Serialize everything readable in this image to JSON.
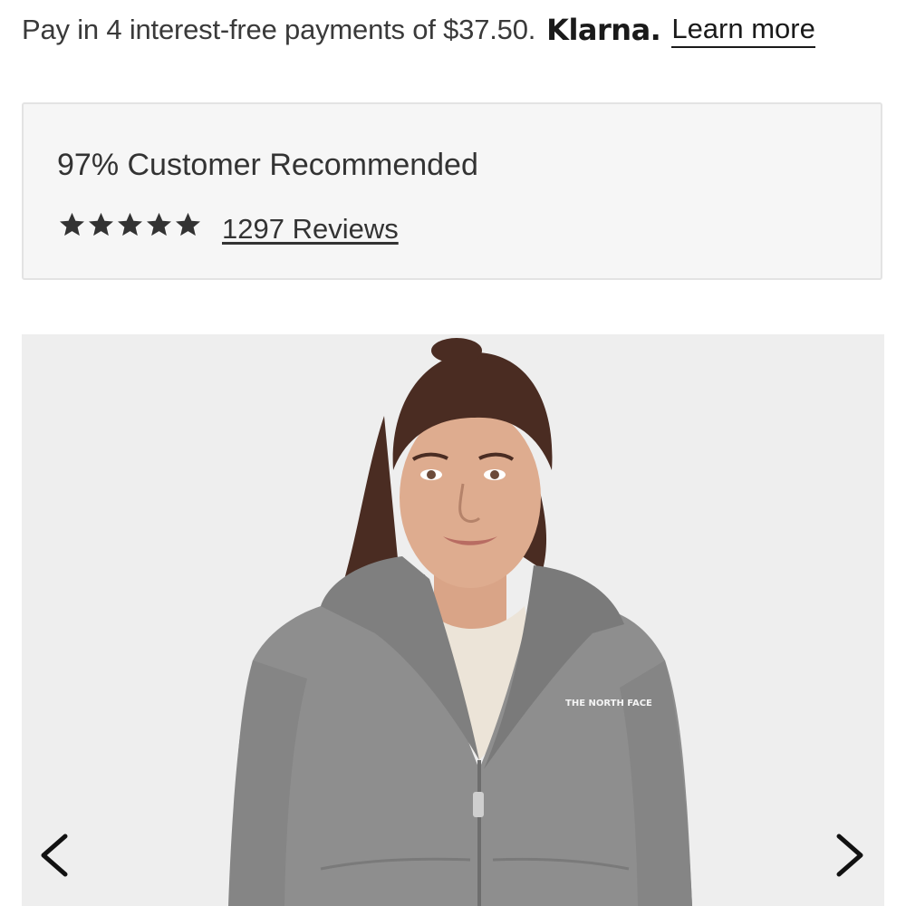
{
  "klarna": {
    "message": "Pay in 4 interest-free payments of $37.50.",
    "logo_text": "Klarna.",
    "learn_more_label": "Learn more"
  },
  "rating": {
    "recommended_text": "97% Customer Recommended",
    "stars": 5,
    "max_stars": 5,
    "reviews_label": "1297 Reviews"
  },
  "gallery": {
    "image_alt": "Product photo: gray hooded jacket",
    "brand_mark_text": "THE NORTH FACE",
    "prev_icon": "chevron-left-icon",
    "next_icon": "chevron-right-icon"
  },
  "colors": {
    "text": "#333333",
    "rating_box_bg": "#f6f6f6",
    "rating_box_border": "#e3e3e3",
    "gallery_bg": "#eeeeee",
    "star": "#333333"
  }
}
